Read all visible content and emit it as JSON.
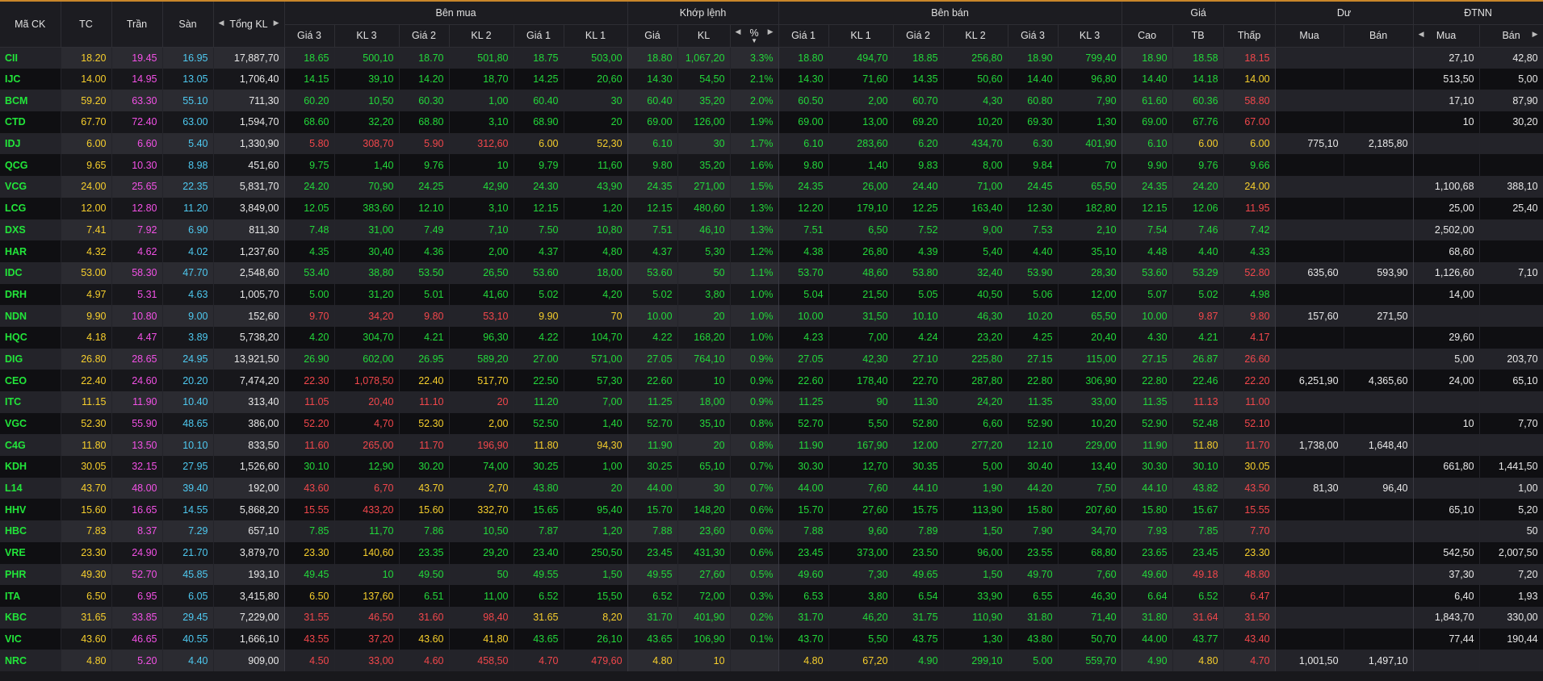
{
  "colors": {
    "ref": "#f7cf2c",
    "ceiling": "#f351e6",
    "floor": "#4ec9f0",
    "up": "#23d83a",
    "down": "#f2474b",
    "white": "#e8e8e8",
    "accent": "#c8862a"
  },
  "headers": {
    "symbol": "Mã CK",
    "ref": "TC",
    "ceiling": "Trần",
    "floor": "Sàn",
    "total_vol": "Tổng KL",
    "bid": "Bên mua",
    "match": "Khớp lệnh",
    "ask": "Bên bán",
    "price": "Giá",
    "remain": "Dư",
    "foreign": "ĐTNN",
    "bid_sub": [
      "Giá 3",
      "KL 3",
      "Giá 2",
      "KL 2",
      "Giá 1",
      "KL 1"
    ],
    "match_sub": [
      "Giá",
      "KL",
      "%"
    ],
    "ask_sub": [
      "Giá 1",
      "KL 1",
      "Giá 2",
      "KL 2",
      "Giá 3",
      "KL 3"
    ],
    "price_sub": [
      "Cao",
      "TB",
      "Thấp"
    ],
    "remain_sub": [
      "Mua",
      "Bán"
    ],
    "foreign_sub": [
      "Mua",
      "Bán"
    ]
  },
  "rows": [
    [
      "CII",
      "18.20",
      "19.45",
      "16.95",
      "17,887,70",
      "18.65",
      "500,10",
      "18.70",
      "501,80",
      "18.75",
      "503,00",
      "18.80",
      "1,067,20",
      "3.3%",
      "18.80",
      "494,70",
      "18.85",
      "256,80",
      "18.90",
      "799,40",
      "18.90",
      "18.58",
      "18.15",
      "",
      "",
      "27,10",
      "42,80"
    ],
    [
      "IJC",
      "14.00",
      "14.95",
      "13.05",
      "1,706,40",
      "14.15",
      "39,10",
      "14.20",
      "18,70",
      "14.25",
      "20,60",
      "14.30",
      "54,50",
      "2.1%",
      "14.30",
      "71,60",
      "14.35",
      "50,60",
      "14.40",
      "96,80",
      "14.40",
      "14.18",
      "14.00",
      "",
      "",
      "513,50",
      "5,00"
    ],
    [
      "BCM",
      "59.20",
      "63.30",
      "55.10",
      "711,30",
      "60.20",
      "10,50",
      "60.30",
      "1,00",
      "60.40",
      "30",
      "60.40",
      "35,20",
      "2.0%",
      "60.50",
      "2,00",
      "60.70",
      "4,30",
      "60.80",
      "7,90",
      "61.60",
      "60.36",
      "58.80",
      "",
      "",
      "17,10",
      "87,90"
    ],
    [
      "CTD",
      "67.70",
      "72.40",
      "63.00",
      "1,594,70",
      "68.60",
      "32,20",
      "68.80",
      "3,10",
      "68.90",
      "20",
      "69.00",
      "126,00",
      "1.9%",
      "69.00",
      "13,00",
      "69.20",
      "10,20",
      "69.30",
      "1,30",
      "69.00",
      "67.76",
      "67.00",
      "",
      "",
      "10",
      "30,20"
    ],
    [
      "IDJ",
      "6.00",
      "6.60",
      "5.40",
      "1,330,90",
      "5.80",
      "308,70",
      "5.90",
      "312,60",
      "6.00",
      "52,30",
      "6.10",
      "30",
      "1.7%",
      "6.10",
      "283,60",
      "6.20",
      "434,70",
      "6.30",
      "401,90",
      "6.10",
      "6.00",
      "6.00",
      "775,10",
      "2,185,80",
      "",
      ""
    ],
    [
      "QCG",
      "9.65",
      "10.30",
      "8.98",
      "451,60",
      "9.75",
      "1,40",
      "9.76",
      "10",
      "9.79",
      "11,60",
      "9.80",
      "35,20",
      "1.6%",
      "9.80",
      "1,40",
      "9.83",
      "8,00",
      "9.84",
      "70",
      "9.90",
      "9.76",
      "9.66",
      "",
      "",
      "",
      ""
    ],
    [
      "VCG",
      "24.00",
      "25.65",
      "22.35",
      "5,831,70",
      "24.20",
      "70,90",
      "24.25",
      "42,90",
      "24.30",
      "43,90",
      "24.35",
      "271,00",
      "1.5%",
      "24.35",
      "26,00",
      "24.40",
      "71,00",
      "24.45",
      "65,50",
      "24.35",
      "24.20",
      "24.00",
      "",
      "",
      "1,100,68",
      "388,10"
    ],
    [
      "LCG",
      "12.00",
      "12.80",
      "11.20",
      "3,849,00",
      "12.05",
      "383,60",
      "12.10",
      "3,10",
      "12.15",
      "1,20",
      "12.15",
      "480,60",
      "1.3%",
      "12.20",
      "179,10",
      "12.25",
      "163,40",
      "12.30",
      "182,80",
      "12.15",
      "12.06",
      "11.95",
      "",
      "",
      "25,00",
      "25,40"
    ],
    [
      "DXS",
      "7.41",
      "7.92",
      "6.90",
      "811,30",
      "7.48",
      "31,00",
      "7.49",
      "7,10",
      "7.50",
      "10,80",
      "7.51",
      "46,10",
      "1.3%",
      "7.51",
      "6,50",
      "7.52",
      "9,00",
      "7.53",
      "2,10",
      "7.54",
      "7.46",
      "7.42",
      "",
      "",
      "2,502,00",
      ""
    ],
    [
      "HAR",
      "4.32",
      "4.62",
      "4.02",
      "1,237,60",
      "4.35",
      "30,40",
      "4.36",
      "2,00",
      "4.37",
      "4,80",
      "4.37",
      "5,30",
      "1.2%",
      "4.38",
      "26,80",
      "4.39",
      "5,40",
      "4.40",
      "35,10",
      "4.48",
      "4.40",
      "4.33",
      "",
      "",
      "68,60",
      ""
    ],
    [
      "IDC",
      "53.00",
      "58.30",
      "47.70",
      "2,548,60",
      "53.40",
      "38,80",
      "53.50",
      "26,50",
      "53.60",
      "18,00",
      "53.60",
      "50",
      "1.1%",
      "53.70",
      "48,60",
      "53.80",
      "32,40",
      "53.90",
      "28,30",
      "53.60",
      "53.29",
      "52.80",
      "635,60",
      "593,90",
      "1,126,60",
      "7,10"
    ],
    [
      "DRH",
      "4.97",
      "5.31",
      "4.63",
      "1,005,70",
      "5.00",
      "31,20",
      "5.01",
      "41,60",
      "5.02",
      "4,20",
      "5.02",
      "3,80",
      "1.0%",
      "5.04",
      "21,50",
      "5.05",
      "40,50",
      "5.06",
      "12,00",
      "5.07",
      "5.02",
      "4.98",
      "",
      "",
      "14,00",
      ""
    ],
    [
      "NDN",
      "9.90",
      "10.80",
      "9.00",
      "152,60",
      "9.70",
      "34,20",
      "9.80",
      "53,10",
      "9.90",
      "70",
      "10.00",
      "20",
      "1.0%",
      "10.00",
      "31,50",
      "10.10",
      "46,30",
      "10.20",
      "65,50",
      "10.00",
      "9.87",
      "9.80",
      "157,60",
      "271,50",
      "",
      ""
    ],
    [
      "HQC",
      "4.18",
      "4.47",
      "3.89",
      "5,738,20",
      "4.20",
      "304,70",
      "4.21",
      "96,30",
      "4.22",
      "104,70",
      "4.22",
      "168,20",
      "1.0%",
      "4.23",
      "7,00",
      "4.24",
      "23,20",
      "4.25",
      "20,40",
      "4.30",
      "4.21",
      "4.17",
      "",
      "",
      "29,60",
      ""
    ],
    [
      "DIG",
      "26.80",
      "28.65",
      "24.95",
      "13,921,50",
      "26.90",
      "602,00",
      "26.95",
      "589,20",
      "27.00",
      "571,00",
      "27.05",
      "764,10",
      "0.9%",
      "27.05",
      "42,30",
      "27.10",
      "225,80",
      "27.15",
      "115,00",
      "27.15",
      "26.87",
      "26.60",
      "",
      "",
      "5,00",
      "203,70"
    ],
    [
      "CEO",
      "22.40",
      "24.60",
      "20.20",
      "7,474,20",
      "22.30",
      "1,078,50",
      "22.40",
      "517,70",
      "22.50",
      "57,30",
      "22.60",
      "10",
      "0.9%",
      "22.60",
      "178,40",
      "22.70",
      "287,80",
      "22.80",
      "306,90",
      "22.80",
      "22.46",
      "22.20",
      "6,251,90",
      "4,365,60",
      "24,00",
      "65,10"
    ],
    [
      "ITC",
      "11.15",
      "11.90",
      "10.40",
      "313,40",
      "11.05",
      "20,40",
      "11.10",
      "20",
      "11.20",
      "7,00",
      "11.25",
      "18,00",
      "0.9%",
      "11.25",
      "90",
      "11.30",
      "24,20",
      "11.35",
      "33,00",
      "11.35",
      "11.13",
      "11.00",
      "",
      "",
      "",
      ""
    ],
    [
      "VGC",
      "52.30",
      "55.90",
      "48.65",
      "386,00",
      "52.20",
      "4,70",
      "52.30",
      "2,00",
      "52.50",
      "1,40",
      "52.70",
      "35,10",
      "0.8%",
      "52.70",
      "5,50",
      "52.80",
      "6,60",
      "52.90",
      "10,20",
      "52.90",
      "52.48",
      "52.10",
      "",
      "",
      "10",
      "7,70"
    ],
    [
      "C4G",
      "11.80",
      "13.50",
      "10.10",
      "833,50",
      "11.60",
      "265,00",
      "11.70",
      "196,90",
      "11.80",
      "94,30",
      "11.90",
      "20",
      "0.8%",
      "11.90",
      "167,90",
      "12.00",
      "277,20",
      "12.10",
      "229,00",
      "11.90",
      "11.80",
      "11.70",
      "1,738,00",
      "1,648,40",
      "",
      ""
    ],
    [
      "KDH",
      "30.05",
      "32.15",
      "27.95",
      "1,526,60",
      "30.10",
      "12,90",
      "30.20",
      "74,00",
      "30.25",
      "1,00",
      "30.25",
      "65,10",
      "0.7%",
      "30.30",
      "12,70",
      "30.35",
      "5,00",
      "30.40",
      "13,40",
      "30.30",
      "30.10",
      "30.05",
      "",
      "",
      "661,80",
      "1,441,50"
    ],
    [
      "L14",
      "43.70",
      "48.00",
      "39.40",
      "192,00",
      "43.60",
      "6,70",
      "43.70",
      "2,70",
      "43.80",
      "20",
      "44.00",
      "30",
      "0.7%",
      "44.00",
      "7,60",
      "44.10",
      "1,90",
      "44.20",
      "7,50",
      "44.10",
      "43.82",
      "43.50",
      "81,30",
      "96,40",
      "",
      "1,00"
    ],
    [
      "HHV",
      "15.60",
      "16.65",
      "14.55",
      "5,868,20",
      "15.55",
      "433,20",
      "15.60",
      "332,70",
      "15.65",
      "95,40",
      "15.70",
      "148,20",
      "0.6%",
      "15.70",
      "27,60",
      "15.75",
      "113,90",
      "15.80",
      "207,60",
      "15.80",
      "15.67",
      "15.55",
      "",
      "",
      "65,10",
      "5,20"
    ],
    [
      "HBC",
      "7.83",
      "8.37",
      "7.29",
      "657,10",
      "7.85",
      "11,70",
      "7.86",
      "10,50",
      "7.87",
      "1,20",
      "7.88",
      "23,60",
      "0.6%",
      "7.88",
      "9,60",
      "7.89",
      "1,50",
      "7.90",
      "34,70",
      "7.93",
      "7.85",
      "7.70",
      "",
      "",
      "",
      "50"
    ],
    [
      "VRE",
      "23.30",
      "24.90",
      "21.70",
      "3,879,70",
      "23.30",
      "140,60",
      "23.35",
      "29,20",
      "23.40",
      "250,50",
      "23.45",
      "431,30",
      "0.6%",
      "23.45",
      "373,00",
      "23.50",
      "96,00",
      "23.55",
      "68,80",
      "23.65",
      "23.45",
      "23.30",
      "",
      "",
      "542,50",
      "2,007,50"
    ],
    [
      "PHR",
      "49.30",
      "52.70",
      "45.85",
      "193,10",
      "49.45",
      "10",
      "49.50",
      "50",
      "49.55",
      "1,50",
      "49.55",
      "27,60",
      "0.5%",
      "49.60",
      "7,30",
      "49.65",
      "1,50",
      "49.70",
      "7,60",
      "49.60",
      "49.18",
      "48.80",
      "",
      "",
      "37,30",
      "7,20"
    ],
    [
      "ITA",
      "6.50",
      "6.95",
      "6.05",
      "3,415,80",
      "6.50",
      "137,60",
      "6.51",
      "11,00",
      "6.52",
      "15,50",
      "6.52",
      "72,00",
      "0.3%",
      "6.53",
      "3,80",
      "6.54",
      "33,90",
      "6.55",
      "46,30",
      "6.64",
      "6.52",
      "6.47",
      "",
      "",
      "6,40",
      "1,93"
    ],
    [
      "KBC",
      "31.65",
      "33.85",
      "29.45",
      "7,229,00",
      "31.55",
      "46,50",
      "31.60",
      "98,40",
      "31.65",
      "8,20",
      "31.70",
      "401,90",
      "0.2%",
      "31.70",
      "46,20",
      "31.75",
      "110,90",
      "31.80",
      "71,40",
      "31.80",
      "31.64",
      "31.50",
      "",
      "",
      "1,843,70",
      "330,00"
    ],
    [
      "VIC",
      "43.60",
      "46.65",
      "40.55",
      "1,666,10",
      "43.55",
      "37,20",
      "43.60",
      "41,80",
      "43.65",
      "26,10",
      "43.65",
      "106,90",
      "0.1%",
      "43.70",
      "5,50",
      "43.75",
      "1,30",
      "43.80",
      "50,70",
      "44.00",
      "43.77",
      "43.40",
      "",
      "",
      "77,44",
      "190,44"
    ],
    [
      "NRC",
      "4.80",
      "5.20",
      "4.40",
      "909,00",
      "4.50",
      "33,00",
      "4.60",
      "458,50",
      "4.70",
      "479,60",
      "4.80",
      "10",
      "",
      "4.80",
      "67,20",
      "4.90",
      "299,10",
      "5.00",
      "559,70",
      "4.90",
      "4.80",
      "4.70",
      "1,001,50",
      "1,497,10",
      "",
      ""
    ]
  ]
}
